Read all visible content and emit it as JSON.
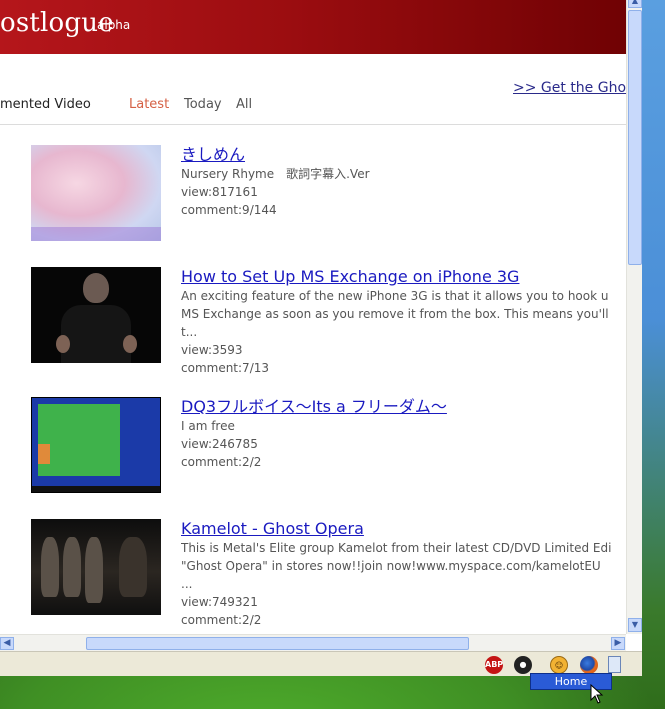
{
  "site": {
    "logo_text": "ostlogue",
    "badge": "alpha"
  },
  "nav": {
    "title": "mented Video",
    "tabs": [
      {
        "label": "Latest",
        "active": true
      },
      {
        "label": "Today"
      },
      {
        "label": "All"
      }
    ],
    "get_link": ">> Get the Gho"
  },
  "videos": [
    {
      "title": "きしめん",
      "desc": "Nursery Rhyme　歌詞字幕入.Ver",
      "view": "view:817161",
      "comment": "comment:9/144",
      "thumb": "anime-icon"
    },
    {
      "title": "How to Set Up MS Exchange on iPhone 3G",
      "desc_lines": [
        "An exciting feature of the new iPhone 3G is that it allows you to hook u",
        "MS Exchange as soon as you remove it from the box. This means you'll",
        "t..."
      ],
      "view": "view:3593",
      "comment": "comment:7/13",
      "thumb": "person-icon"
    },
    {
      "title": "DQ3フルボイス～Its a フリーダム～",
      "desc": "I am free",
      "view": "view:246785",
      "comment": "comment:2/2",
      "thumb": "game-map-icon"
    },
    {
      "title": "Kamelot - Ghost Opera",
      "desc_lines": [
        "This is Metal's Elite group Kamelot from their latest CD/DVD Limited Edi",
        "\"Ghost Opera\" in stores now!!join now!www.myspace.com/kamelotEU",
        "..."
      ],
      "view": "view:749321",
      "comment": "comment:2/2",
      "thumb": "band-icon"
    }
  ],
  "statusbar": {
    "icons": [
      "adblock-icon",
      "ghost-icon",
      "smiley-icon",
      "firefox-icon",
      "page-icon"
    ],
    "abp_text": "ABP",
    "tooltip": "Home"
  },
  "colors": {
    "header_red": "#9b0d10",
    "link_blue": "#1a1ac0",
    "active_tab": "#d56044"
  }
}
